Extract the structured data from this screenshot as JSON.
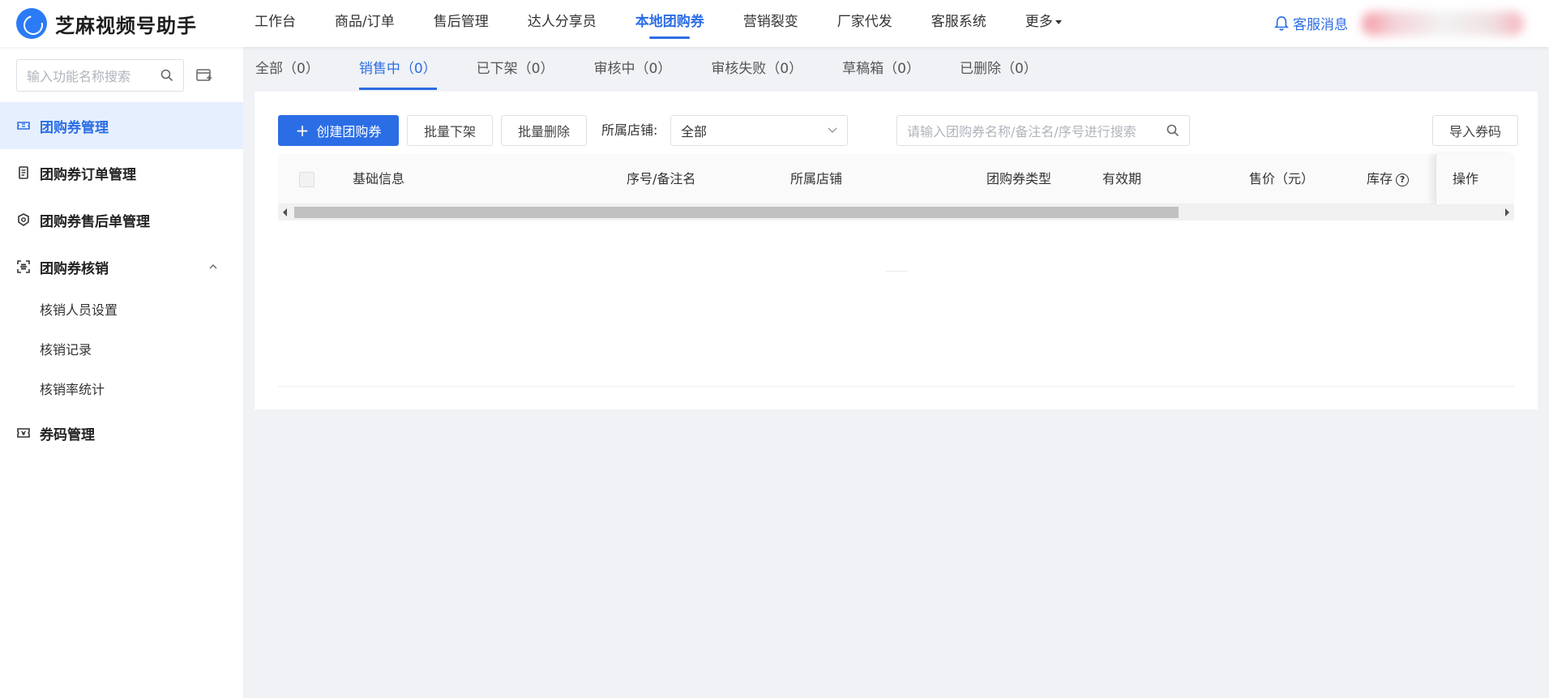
{
  "app": {
    "title": "芝麻视频号助手"
  },
  "topnav": {
    "items": [
      {
        "label": "工作台"
      },
      {
        "label": "商品/订单"
      },
      {
        "label": "售后管理"
      },
      {
        "label": "达人分享员"
      },
      {
        "label": "本地团购券",
        "active": true
      },
      {
        "label": "营销裂变"
      },
      {
        "label": "厂家代发"
      },
      {
        "label": "客服系统"
      },
      {
        "label": "更多"
      }
    ],
    "messages_label": "客服消息"
  },
  "sidebar": {
    "search_placeholder": "输入功能名称搜索",
    "menu": [
      {
        "label": "团购券管理",
        "icon": "ticket-icon",
        "active": true
      },
      {
        "label": "团购券订单管理",
        "icon": "receipt-icon"
      },
      {
        "label": "团购券售后单管理",
        "icon": "shield-icon"
      },
      {
        "label": "团购券核销",
        "icon": "scan-icon",
        "expanded": true,
        "children": [
          {
            "label": "核销人员设置"
          },
          {
            "label": "核销记录"
          },
          {
            "label": "核销率统计"
          }
        ]
      },
      {
        "label": "券码管理",
        "icon": "coupon-icon"
      }
    ]
  },
  "tabs": [
    {
      "label": "全部（0）"
    },
    {
      "label": "销售中（0）",
      "active": true
    },
    {
      "label": "已下架（0）"
    },
    {
      "label": "审核中（0）"
    },
    {
      "label": "审核失败（0）"
    },
    {
      "label": "草稿箱（0）"
    },
    {
      "label": "已删除（0）"
    }
  ],
  "toolbar": {
    "create_label": "创建团购券",
    "batch_off_label": "批量下架",
    "batch_delete_label": "批量删除",
    "store_label": "所属店铺:",
    "store_value": "全部",
    "search_placeholder": "请输入团购券名称/备注名/序号进行搜索",
    "import_label": "导入券码"
  },
  "table": {
    "columns": [
      "基础信息",
      "序号/备注名",
      "所属店铺",
      "团购券类型",
      "有效期",
      "售价（元）",
      "库存",
      "操作"
    ],
    "rows": []
  },
  "colors": {
    "accent": "#2b6de5",
    "active_bg": "#e6effd"
  }
}
